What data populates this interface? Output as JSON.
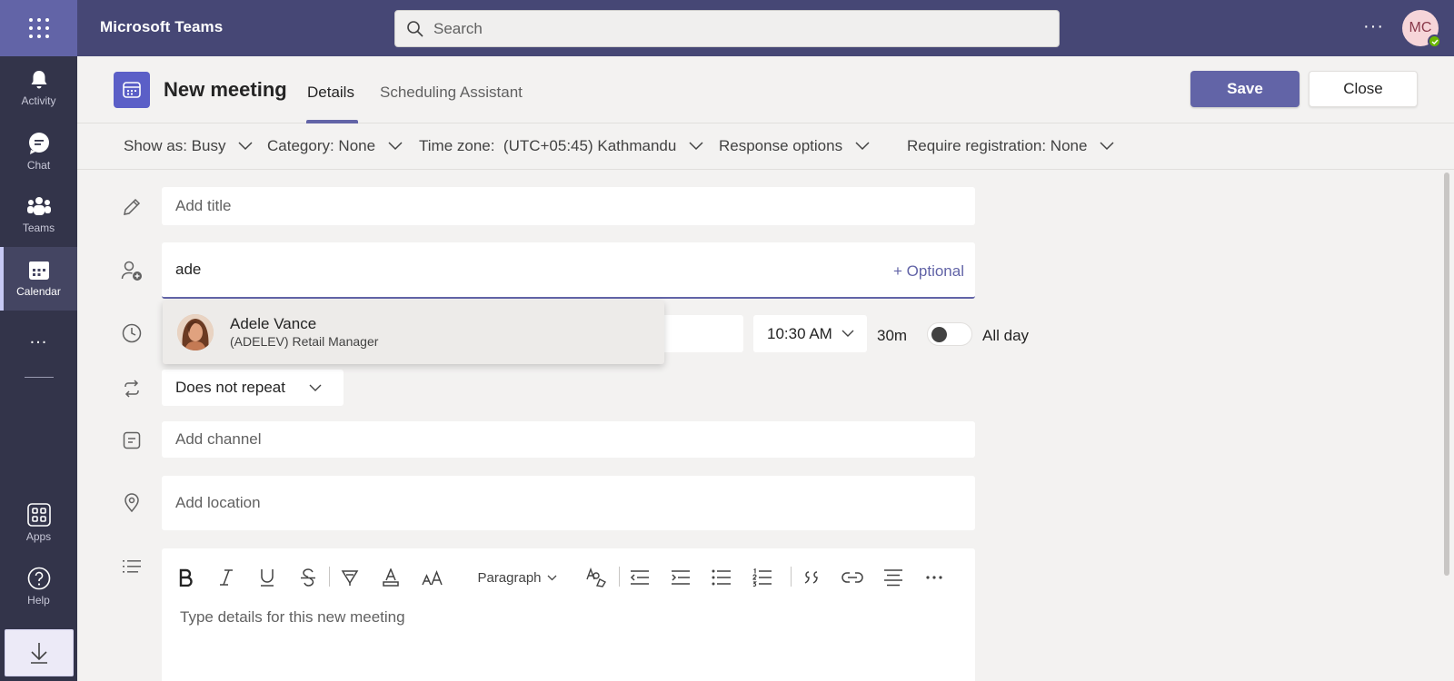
{
  "app": {
    "title": "Microsoft Teams"
  },
  "search": {
    "placeholder": "Search"
  },
  "user": {
    "initials": "MC",
    "status_color": "#6bb700"
  },
  "rail": {
    "items": [
      {
        "label": "Activity",
        "icon": "bell-icon"
      },
      {
        "label": "Chat",
        "icon": "chat-icon"
      },
      {
        "label": "Teams",
        "icon": "teams-icon"
      },
      {
        "label": "Calendar",
        "icon": "calendar-icon",
        "active": true
      },
      {
        "label": "Apps",
        "icon": "apps-icon"
      },
      {
        "label": "Help",
        "icon": "help-icon"
      }
    ],
    "more": "..."
  },
  "header": {
    "title": "New meeting",
    "tabs": [
      {
        "label": "Details",
        "active": true
      },
      {
        "label": "Scheduling Assistant"
      }
    ],
    "save_label": "Save",
    "close_label": "Close"
  },
  "options": {
    "show_as": "Show as: Busy",
    "category": "Category: None",
    "timezone": "Time zone:  (UTC+05:45) Kathmandu",
    "response": "Response options",
    "registration": "Require registration: None"
  },
  "form": {
    "title_placeholder": "Add title",
    "attendees_value": "ade",
    "optional_label": "+ Optional",
    "end_time": "10:30 AM",
    "duration": "30m",
    "all_day_label": "All day",
    "repeat": "Does not repeat",
    "channel_placeholder": "Add channel",
    "location_placeholder": "Add location",
    "details_placeholder": "Type details for this new meeting"
  },
  "suggestion": {
    "name": "Adele Vance",
    "subtitle": "(ADELEV) Retail Manager"
  },
  "editor": {
    "paragraph_label": "Paragraph",
    "tools": [
      "bold",
      "italic",
      "underline",
      "strikethrough",
      "highlight",
      "font-color",
      "font-size",
      "paragraph",
      "clear-format",
      "decrease-indent",
      "increase-indent",
      "bullet-list",
      "numbered-list",
      "quote",
      "link",
      "align",
      "more"
    ]
  },
  "colors": {
    "brand": "#6264a7",
    "topbar": "#464775",
    "rail": "#33344a"
  }
}
